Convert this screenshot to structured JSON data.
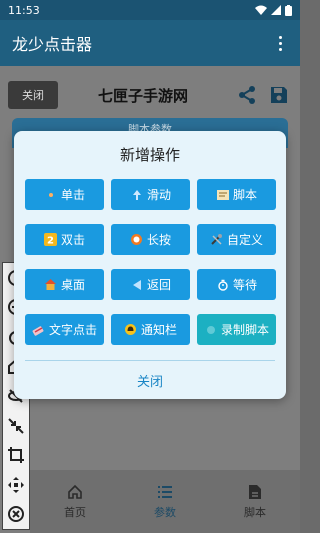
{
  "status_bar": {
    "time": "11:53"
  },
  "app_bar": {
    "title": "龙少点击器"
  },
  "toolbar": {
    "close_label": "关闭",
    "game_name": "七匣子手游网"
  },
  "peek": {
    "label": "脚本参数"
  },
  "dialog": {
    "title": "新增操作",
    "buttons": [
      {
        "label": "单击",
        "icon": "dot-icon"
      },
      {
        "label": "滑动",
        "icon": "arrow-up-icon"
      },
      {
        "label": "脚本",
        "icon": "script-icon"
      },
      {
        "label": "双击",
        "icon": "number-2-icon"
      },
      {
        "label": "长按",
        "icon": "ring-icon"
      },
      {
        "label": "自定义",
        "icon": "tools-icon"
      },
      {
        "label": "桌面",
        "icon": "house-icon"
      },
      {
        "label": "返回",
        "icon": "back-triangle-icon"
      },
      {
        "label": "等待",
        "icon": "timer-icon"
      },
      {
        "label": "文字点击",
        "icon": "text-click-icon"
      },
      {
        "label": "通知栏",
        "icon": "bell-icon"
      },
      {
        "label": "录制脚本",
        "icon": "record-icon"
      }
    ],
    "close_label": "关闭"
  },
  "bottom_nav": [
    {
      "label": "首页",
      "icon": "home-icon"
    },
    {
      "label": "参数",
      "icon": "list-icon"
    },
    {
      "label": "脚本",
      "icon": "document-icon"
    }
  ],
  "colors": {
    "primary": "#1f5f80",
    "button": "#1a9ae0",
    "button_alt": "#1cb0c2",
    "dialog_bg": "#e6f4fb"
  }
}
